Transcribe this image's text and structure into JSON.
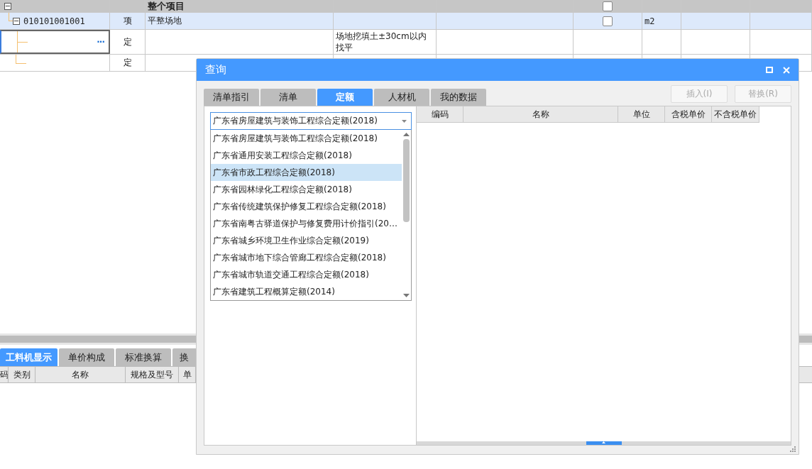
{
  "grid": {
    "header": {
      "title": "整个项目",
      "expanded": true,
      "checked": false
    },
    "rows": [
      {
        "kind": "item",
        "code": "010101001001",
        "expanded": true,
        "type": "项",
        "name": "平整场地",
        "checked": false,
        "unit": "m2",
        "selected": true,
        "focused": false
      },
      {
        "kind": "quota",
        "type": "定",
        "content": "场地挖填土±30cm以内找平",
        "more": "···",
        "selected": false,
        "focused": true
      },
      {
        "kind": "quota",
        "type": "定",
        "selected": false,
        "focused": false
      }
    ]
  },
  "bottom_panel": {
    "tabs": [
      {
        "label": "工料机显示",
        "selected": true
      },
      {
        "label": "单价构成",
        "selected": false
      },
      {
        "label": "标准换算",
        "selected": false
      },
      {
        "label": "换",
        "selected": false
      }
    ],
    "columns": [
      "码",
      "类别",
      "名称",
      "规格及型号",
      "单"
    ]
  },
  "dialog": {
    "title": "查询",
    "tabs": [
      {
        "label": "清单指引",
        "selected": false
      },
      {
        "label": "清单",
        "selected": false
      },
      {
        "label": "定额",
        "selected": true
      },
      {
        "label": "人材机",
        "selected": false
      },
      {
        "label": "我的数据",
        "selected": false
      }
    ],
    "buttons": [
      {
        "label": "插入(I)",
        "disabled": true
      },
      {
        "label": "替换(R)",
        "disabled": true
      }
    ],
    "combo": {
      "value": "广东省房屋建筑与装饰工程综合定额(2018)",
      "expanded": true
    },
    "options": [
      {
        "label": "广东省房屋建筑与装饰工程综合定额(2018)",
        "selected": false
      },
      {
        "label": "广东省通用安装工程综合定额(2018)",
        "selected": false
      },
      {
        "label": "广东省市政工程综合定额(2018)",
        "selected": true
      },
      {
        "label": "广东省园林绿化工程综合定额(2018)",
        "selected": false
      },
      {
        "label": "广东省传统建筑保护修复工程综合定额(2018)",
        "selected": false
      },
      {
        "label": "广东省南粤古驿道保护与修复费用计价指引(20…",
        "selected": false
      },
      {
        "label": "广东省城乡环境卫生作业综合定额(2019)",
        "selected": false
      },
      {
        "label": "广东省城市地下综合管廊工程综合定额(2018)",
        "selected": false
      },
      {
        "label": "广东省城市轨道交通工程综合定额(2018)",
        "selected": false
      },
      {
        "label": "广东省建筑工程概算定额(2014)",
        "selected": false
      }
    ],
    "columns": [
      "编码",
      "名称",
      "单位",
      "含税单价",
      "不含税单价"
    ]
  }
}
